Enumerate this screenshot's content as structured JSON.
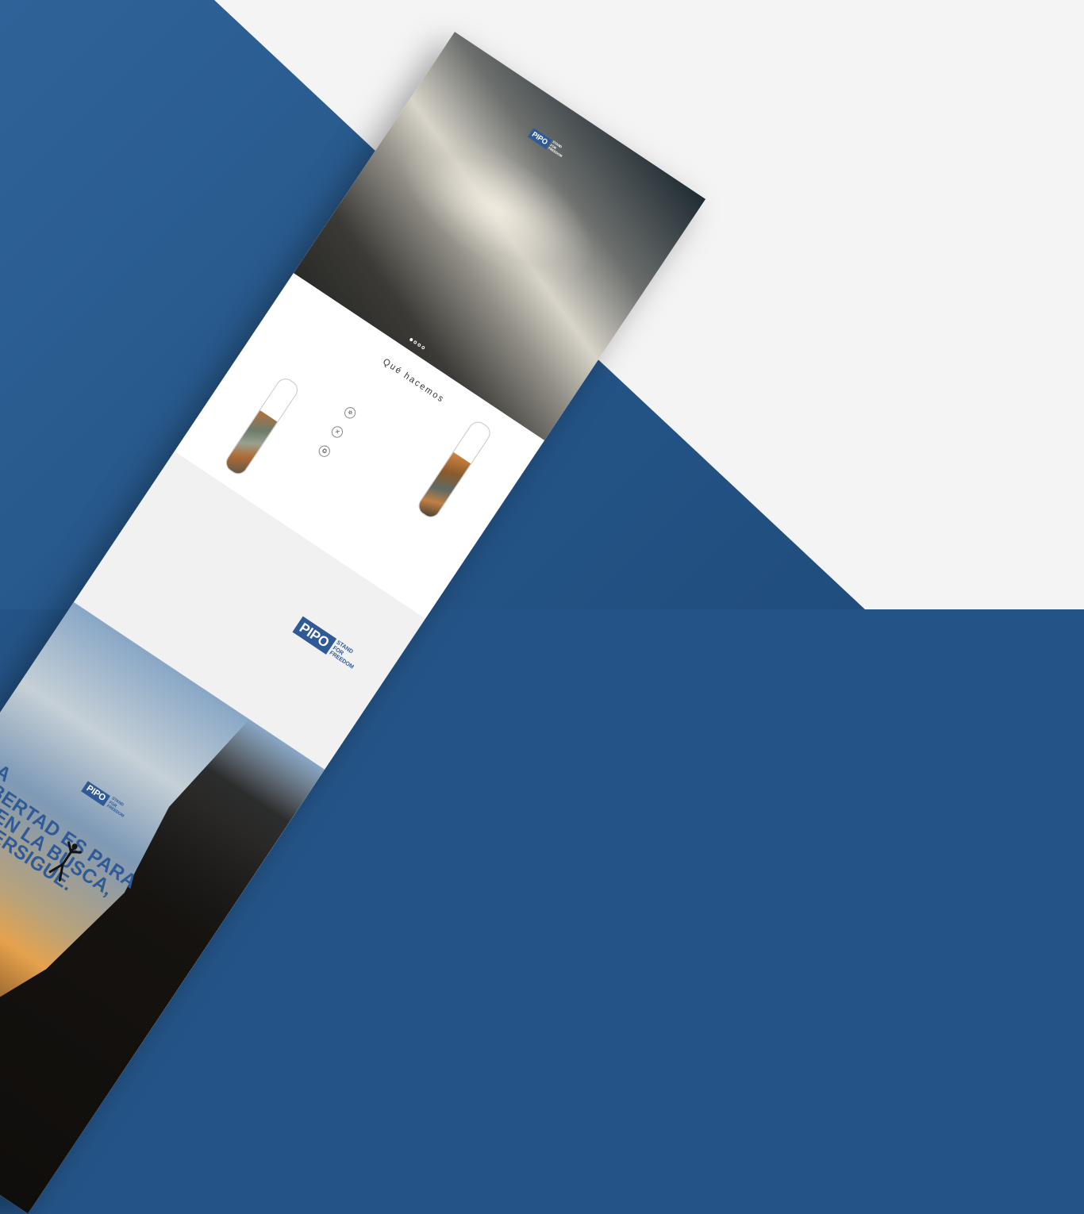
{
  "scene": {
    "background_color": "#245487",
    "wall_color": "#f4f4f4",
    "accent_color": "#2f5a96"
  },
  "nav": {
    "items": [
      "",
      "",
      "",
      ""
    ]
  },
  "brand": {
    "name": "PIPO",
    "tagline_lines": [
      "STAND",
      "FOR",
      "FREEDOM"
    ]
  },
  "hero": {
    "slide_count": 4,
    "active_slide": 1
  },
  "about": {
    "title": "Qué hacemos",
    "intro": "",
    "features": [
      {
        "icon": "gear-icon",
        "text": ""
      },
      {
        "icon": "ski-icon",
        "text": ""
      },
      {
        "icon": "badge-icon",
        "text": ""
      }
    ]
  },
  "mid": {
    "paragraph": ""
  },
  "sunset": {
    "headline_lines": [
      "LA",
      "LIBERTAD ES PARA",
      "QUIEN LA BUSCA,",
      "LA PERSIGUE."
    ],
    "slide_count": 2,
    "active_slide": 1
  }
}
